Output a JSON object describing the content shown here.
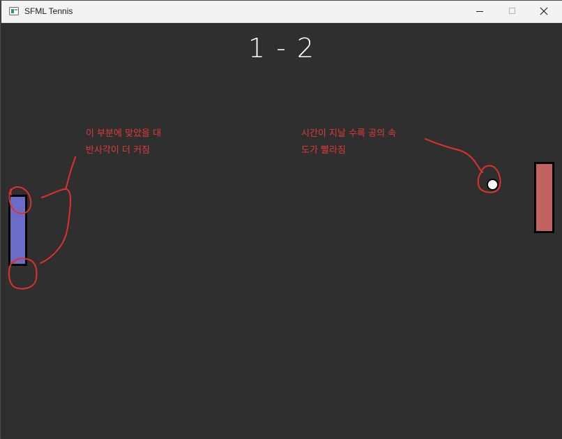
{
  "window": {
    "title": "SFML Tennis",
    "icon": "app-window-icon",
    "controls": [
      "minimize-icon",
      "maximize-icon",
      "close-icon"
    ]
  },
  "game": {
    "score": "1 - 2",
    "left_paddle_color": "#6b6bc8",
    "right_paddle_color": "#c46262",
    "ball_color": "#ffffff",
    "background_color": "#2f2f2f"
  },
  "annotations": {
    "color": "#e03a3a",
    "left_note": {
      "line1": "이 부분에 맞았을 대",
      "line2": "반사각이 더 커짐"
    },
    "right_note": {
      "line1": "시간이 지날 수록 공의 속",
      "line2": "도가 빨라짐"
    }
  }
}
